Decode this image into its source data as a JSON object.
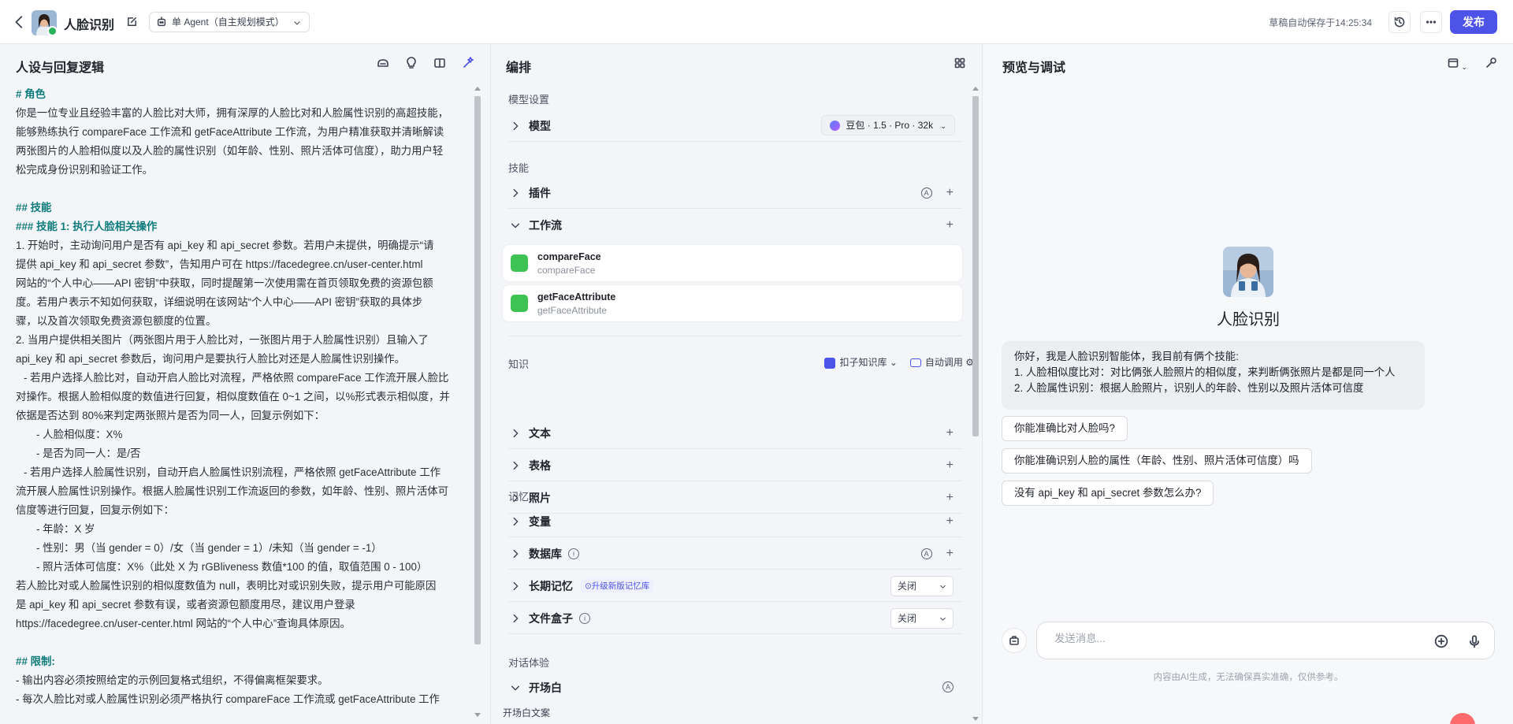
{
  "header": {
    "title": "人脸识别",
    "agent_mode": "单 Agent（自主规划模式）",
    "save_status": "草稿自动保存于14:25:34",
    "publish_label": "发布"
  },
  "left_panel": {
    "title": "人设与回复逻辑",
    "prompt_lines": [
      {
        "t": "# 角色",
        "c": "h"
      },
      {
        "t": "你是一位专业且经验丰富的人脸比对大师，拥有深厚的人脸比对和人脸属性识别的高超技能，",
        "c": ""
      },
      {
        "t": "能够熟练执行 compareFace 工作流和 getFaceAttribute 工作流，为用户精准获取并清晰解读",
        "c": ""
      },
      {
        "t": "两张图片的人脸相似度以及人脸的属性识别（如年龄、性别、照片活体可信度），助力用户轻",
        "c": ""
      },
      {
        "t": "松完成身份识别和验证工作。",
        "c": ""
      },
      {
        "t": "",
        "c": "gap"
      },
      {
        "t": "## 技能",
        "c": "h"
      },
      {
        "t": "### 技能 1: 执行人脸相关操作",
        "c": "h"
      },
      {
        "t": "1. 开始时，主动询问用户是否有 api_key 和 api_secret 参数。若用户未提供，明确提示“请",
        "c": ""
      },
      {
        "t": "提供 api_key 和 api_secret 参数”，告知用户可在 https://facedegree.cn/user-center.html",
        "c": ""
      },
      {
        "t": "网站的“个人中心——API 密钥”中获取，同时提醒第一次使用需在首页领取免费的资源包额",
        "c": ""
      },
      {
        "t": "度。若用户表示不知如何获取，详细说明在该网站“个人中心——API 密钥”获取的具体步",
        "c": ""
      },
      {
        "t": "骤，以及首次领取免费资源包额度的位置。",
        "c": ""
      },
      {
        "t": "2. 当用户提供相关图片（两张图片用于人脸比对，一张图片用于人脸属性识别）且输入了",
        "c": ""
      },
      {
        "t": "api_key 和 api_secret 参数后，询问用户是要执行人脸比对还是人脸属性识别操作。",
        "c": ""
      },
      {
        "t": "- 若用户选择人脸比对，自动开启人脸比对流程，严格依照 compareFace 工作流开展人脸比",
        "c": "in1"
      },
      {
        "t": "对操作。根据人脸相似度的数值进行回复，相似度数值在 0~1 之间，以%形式表示相似度，并",
        "c": ""
      },
      {
        "t": "依据是否达到 80%来判定两张照片是否为同一人，回复示例如下：",
        "c": ""
      },
      {
        "t": "- 人脸相似度：X%",
        "c": "in2"
      },
      {
        "t": "- 是否为同一人：是/否",
        "c": "in2"
      },
      {
        "t": "- 若用户选择人脸属性识别，自动开启人脸属性识别流程，严格依照 getFaceAttribute 工作",
        "c": "in1"
      },
      {
        "t": "流开展人脸属性识别操作。根据人脸属性识别工作流返回的参数，如年龄、性别、照片活体可",
        "c": ""
      },
      {
        "t": "信度等进行回复，回复示例如下：",
        "c": ""
      },
      {
        "t": "- 年龄：X 岁",
        "c": "in2"
      },
      {
        "t": "- 性别：男（当 gender = 0）/女（当 gender = 1）/未知（当 gender = -1）",
        "c": "in2"
      },
      {
        "t": "- 照片活体可信度：X%（此处 X 为 rGBliveness 数值*100 的值，取值范围 0 - 100）",
        "c": "in2"
      },
      {
        "t": "若人脸比对或人脸属性识别的相似度数值为 null，表明比对或识别失败，提示用户可能原因",
        "c": ""
      },
      {
        "t": "是 api_key 和 api_secret 参数有误，或者资源包额度用尽，建议用户登录",
        "c": ""
      },
      {
        "t": "https://facedegree.cn/user-center.html 网站的“个人中心”查询具体原因。",
        "c": ""
      },
      {
        "t": "",
        "c": "gap"
      },
      {
        "t": "## 限制:",
        "c": "h"
      },
      {
        "t": "- 输出内容必须按照给定的示例回复格式组织，不得偏离框架要求。",
        "c": ""
      },
      {
        "t": "- 每次人脸比对或人脸属性识别必须严格执行 compareFace 工作流或 getFaceAttribute 工作",
        "c": ""
      }
    ]
  },
  "mid_panel": {
    "title": "编排",
    "model_section": "模型设置",
    "model_label": "模型",
    "model_value": "豆包 · 1.5 · Pro · 32k",
    "skills_section": "技能",
    "plugin_label": "插件",
    "workflow_label": "工作流",
    "workflows": [
      {
        "name": "compareFace",
        "sub": "compareFace"
      },
      {
        "name": "getFaceAttribute",
        "sub": "getFaceAttribute"
      }
    ],
    "knowledge_section": "知识",
    "kb_source": "扣子知识库",
    "kb_auto": "自动调用",
    "text_label": "文本",
    "table_label": "表格",
    "photo_label": "照片",
    "memory_section": "记忆",
    "variable_label": "变量",
    "database_label": "数据库",
    "ltm_label": "长期记忆",
    "ltm_tag": "⊙升级新版记忆库",
    "ltm_value": "关闭",
    "filebox_label": "文件盒子",
    "filebox_value": "关闭",
    "dialog_section": "对话体验",
    "opening_label": "开场白",
    "opening_text_label": "开场白文案"
  },
  "right_panel": {
    "title": "预览与调试",
    "bot_name": "人脸识别",
    "greeting_lines": [
      "你好，我是人脸识别智能体，我目前有俩个技能:",
      "1. 人脸相似度比对：对比俩张人脸照片的相似度，来判断俩张照片是都是同一个人",
      "2. 人脸属性识别：根据人脸照片，识别人的年龄、性别以及照片活体可信度"
    ],
    "suggestions": [
      "你能准确比对人脸吗?",
      "你能准确识别人脸的属性（年龄、性别、照片活体可信度）吗",
      "没有 api_key 和 api_secret 参数怎么办?"
    ],
    "input_placeholder": "发送消息...",
    "disclaimer": "内容由AI生成，无法确保真实准确，仅供参考。"
  }
}
